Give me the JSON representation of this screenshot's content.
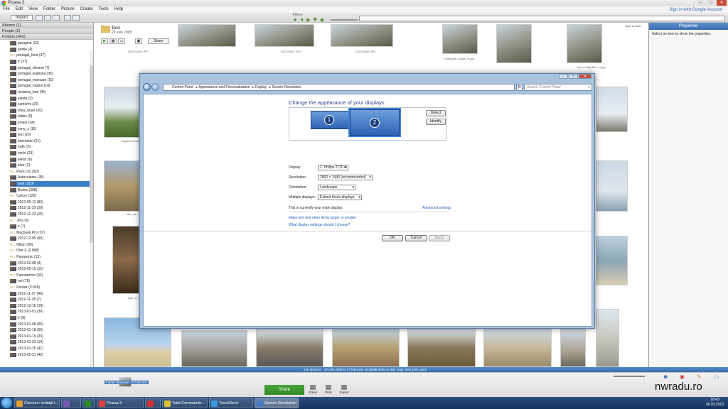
{
  "picasa": {
    "title": "Picasa 3",
    "menu": [
      "File",
      "Edit",
      "View",
      "Folder",
      "Picture",
      "Create",
      "Tools",
      "Help"
    ],
    "signin": "Sign in with Google Account",
    "import_label": "Import",
    "filters_label": "Filters",
    "left_headers": [
      "Albums (1)",
      "People (2)",
      "Folders (642)"
    ],
    "folders": [
      {
        "label": "paragina (10)",
        "thumb": true
      },
      {
        "label": "politie (4)",
        "thumb": true
      },
      {
        "label": "portugal_best (37)",
        "thumb": false
      },
      {
        "label": "tr (37)",
        "thumb": true
      },
      {
        "label": "portugal_diverse (7)",
        "thumb": true
      },
      {
        "label": "portugal_lisabona (36)",
        "thumb": true
      },
      {
        "label": "portugal_mancare (15)",
        "thumb": true
      },
      {
        "label": "portugal_masini (14)",
        "thumb": true
      },
      {
        "label": "reclama_ford (45)",
        "thumb": true
      },
      {
        "label": "salata (2)",
        "thumb": true
      },
      {
        "label": "santorini (20)",
        "thumb": true
      },
      {
        "label": "sibiu_mare (20)",
        "thumb": true
      },
      {
        "label": "slides (5)",
        "thumb": true
      },
      {
        "label": "smalo (34)",
        "thumb": true
      },
      {
        "label": "sony_z (10)",
        "thumb": true
      },
      {
        "label": "test (20)",
        "thumb": true
      },
      {
        "label": "tineretului (21)",
        "thumb": true
      },
      {
        "label": "trafic (5)",
        "thumb": true
      },
      {
        "label": "vechi (23)",
        "thumb": true
      },
      {
        "label": "weiss (6)",
        "thumb": true
      },
      {
        "label": "zbor (2)",
        "thumb": true
      },
      {
        "label": "Poze (10.260)",
        "thumb": false
      },
      {
        "label": "Autocolante (35)",
        "thumb": true
      },
      {
        "label": "best (210)",
        "thumb": true,
        "selected": true
      },
      {
        "label": "Breloc (308)",
        "thumb": true
      },
      {
        "label": "Canon (129)",
        "thumb": false
      },
      {
        "label": "2012-05-12 (83)",
        "thumb": true
      },
      {
        "label": "2012-11-19 (30)",
        "thumb": true
      },
      {
        "label": "2012-12-22 (16)",
        "thumb": true
      },
      {
        "label": "JPG (5)",
        "thumb": false
      },
      {
        "label": "ir (1)",
        "thumb": true
      },
      {
        "label": "Macbook Pro (37)",
        "thumb": false
      },
      {
        "label": "2012-12-05 (90)",
        "thumb": true
      },
      {
        "label": "Nikon (90)",
        "thumb": false
      },
      {
        "label": "One X (2.988)",
        "thumb": false
      },
      {
        "label": "Panasonic (19)",
        "thumb": false
      },
      {
        "label": "2013-02-08 (4)",
        "thumb": true
      },
      {
        "label": "2013-02-15 (15)",
        "thumb": true
      },
      {
        "label": "Panoramice (92)",
        "thumb": false
      },
      {
        "label": "noi (78)",
        "thumb": true
      },
      {
        "label": "Pentax (3.938)",
        "thumb": false
      },
      {
        "label": "2012-11-27 (46)",
        "thumb": true
      },
      {
        "label": "2012-11-28 (7)",
        "thumb": true
      },
      {
        "label": "2012-12-16 (18)",
        "thumb": true
      },
      {
        "label": "2013-01-01 (36)",
        "thumb": true
      },
      {
        "label": "tr (8)",
        "thumb": true
      },
      {
        "label": "2013-01-08 (55)",
        "thumb": true
      },
      {
        "label": "2013-01-18 (55)",
        "thumb": true
      },
      {
        "label": "2013-01-19 (23)",
        "thumb": true
      },
      {
        "label": "2013-01-23 (19)",
        "thumb": true
      },
      {
        "label": "2013-01-25 (41)",
        "thumb": true
      },
      {
        "label": "2013-02-21 (42)",
        "thumb": true
      }
    ],
    "album": {
      "title": "Best",
      "date": "22 iulie 2005",
      "share_label": "Share",
      "sync_label": "Sync to Web"
    },
    "captions": [
      "DSC03289.JPG",
      "DSC03357.JPG",
      "DSC03455.JPG",
      "Edinburgh-Castle_cr.jpg",
      "Eye-on Big Ben_cr.jpg",
      "Pagaras Mous...",
      "fotc_alt...",
      "ladc_2..."
    ],
    "properties": {
      "title": "Properties",
      "hint": "Select an item to show the properties."
    },
    "status": {
      "count": "210 pictures",
      "range": "22 iulie 2005 to 27 februarie 2013",
      "size": "688,4MB on disk",
      "tags": "Tags: best (10), paris"
    },
    "tray": {
      "held": "Folder Selected - 210 photos",
      "share": "Share",
      "email": "Email",
      "print": "Print",
      "export": "Export"
    },
    "watermark": "nwradu.ro"
  },
  "taskbar": {
    "tasks": [
      {
        "label": "Concurs: invitații l...",
        "color": "#e0a030"
      },
      {
        "label": "",
        "color": "#7a5ab8"
      },
      {
        "label": "",
        "color": "#2f8a23"
      },
      {
        "label": "Picasa 3",
        "color": "#e04040"
      },
      {
        "label": "",
        "color": "#d83030"
      },
      {
        "label": "Total Commande...",
        "color": "#d8c030"
      },
      {
        "label": "TweetDeck",
        "color": "#3a9ae0"
      },
      {
        "label": "Screen Resolution",
        "color": "#4a7ac9",
        "active": true
      }
    ],
    "time": "18:43",
    "date": "06.03.2013"
  },
  "dialog": {
    "breadcrumbs": [
      "Control Panel",
      "Appearance and Personalization",
      "Display",
      "Screen Resolution"
    ],
    "search_placeholder": "Search Control Panel",
    "heading": "Change the appearance of your displays",
    "detect": "Detect",
    "identify": "Identify",
    "monitor1": "1",
    "monitor2": "2",
    "display_label": "Display:",
    "display_value": "2. Philips 272C4",
    "resolution_label": "Resolution:",
    "resolution_value": "2560 × 1440 (recommended)",
    "orientation_label": "Orientation:",
    "orientation_value": "Landscape",
    "multiple_label": "Multiple displays:",
    "multiple_value": "Extend these displays",
    "main_display_text": "This is currently your main display.",
    "advanced_link": "Advanced settings",
    "link1": "Make text and other items larger or smaller",
    "link2": "What display settings should I choose?",
    "ok": "OK",
    "cancel": "Cancel",
    "apply": "Apply"
  }
}
